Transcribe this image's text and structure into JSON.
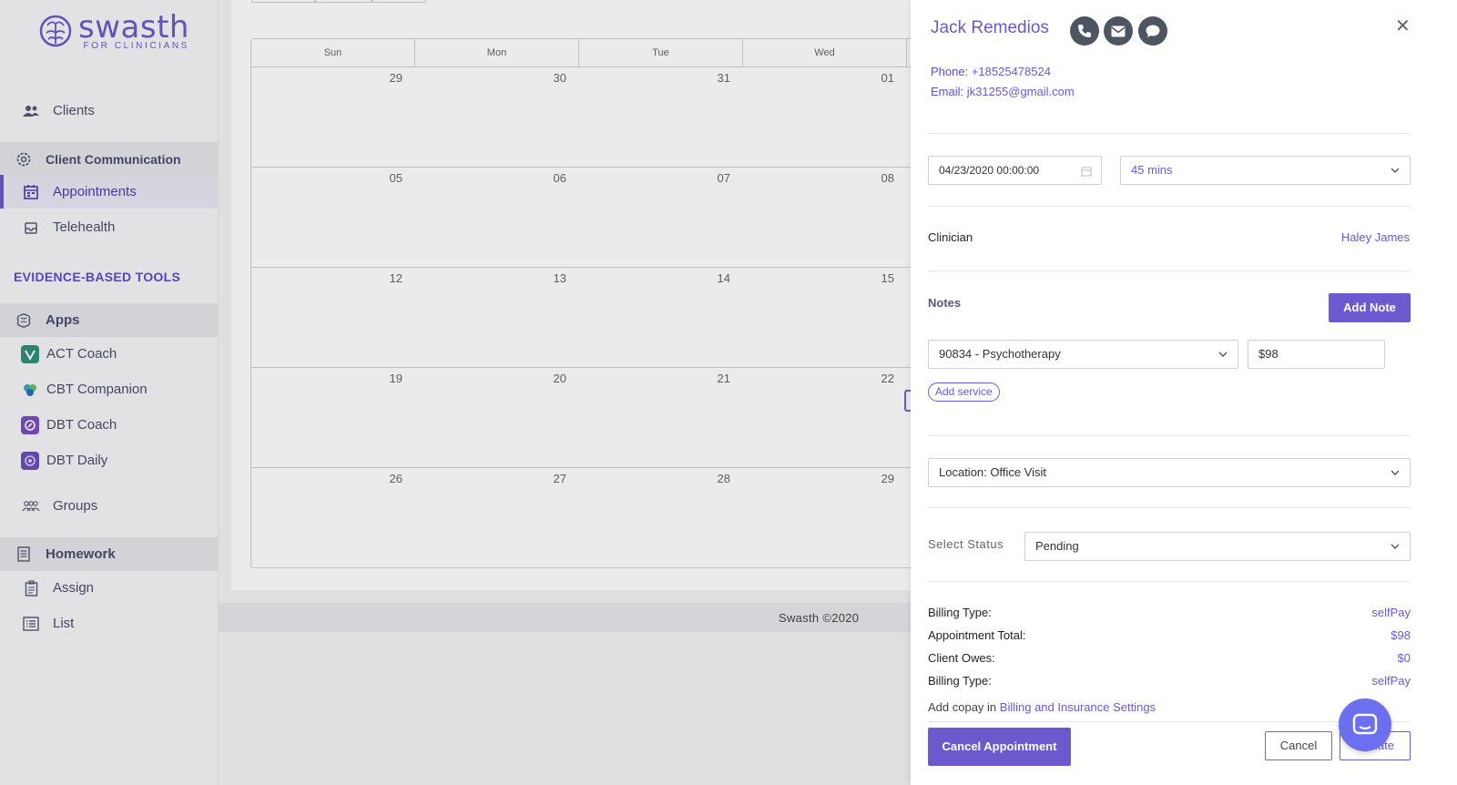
{
  "brand": {
    "name": "swasth",
    "tagline": "FOR CLINICIANS"
  },
  "sidebar": {
    "clients": "Clients",
    "client_communication": "Client Communication",
    "appointments": "Appointments",
    "telehealth": "Telehealth",
    "evidence_title": "EVIDENCE-BASED TOOLS",
    "apps": "Apps",
    "act_coach": "ACT Coach",
    "cbt_companion": "CBT Companion",
    "dbt_coach": "DBT Coach",
    "dbt_daily": "DBT Daily",
    "groups": "Groups",
    "homework": "Homework",
    "assign": "Assign",
    "list": "List"
  },
  "calendar": {
    "days": [
      "Sun",
      "Mon",
      "Tue",
      "Wed"
    ],
    "weeks": [
      [
        "29",
        "30",
        "31",
        "01"
      ],
      [
        "05",
        "06",
        "07",
        "08"
      ],
      [
        "12",
        "13",
        "14",
        "15"
      ],
      [
        "19",
        "20",
        "21",
        "22"
      ],
      [
        "26",
        "27",
        "28",
        "29"
      ]
    ]
  },
  "footer": {
    "text": "Swasth ©2020"
  },
  "drawer": {
    "client_name": "Jack Remedios",
    "phone_label": "Phone:",
    "phone": "+18525478524",
    "email_label": "Email:",
    "email": "jk31255@gmail.com",
    "datetime": "04/23/2020 00:00:00",
    "duration": "45 mins",
    "clinician_label": "Clinician",
    "clinician": "Haley James",
    "notes_label": "Notes",
    "add_note": "Add Note",
    "service": "90834 - Psychotherapy",
    "price": "$98",
    "add_service": "Add service",
    "location": "Location: Office Visit",
    "status_label": "Select Status",
    "status": "Pending",
    "billing": [
      {
        "label": "Billing Type:",
        "value": "selfPay"
      },
      {
        "label": "Appointment Total:",
        "value": "$98"
      },
      {
        "label": "Client Owes:",
        "value": "$0"
      },
      {
        "label": "Billing Type:",
        "value": "selfPay"
      }
    ],
    "copay_prefix": "Add copay in ",
    "copay_link": "Billing and Insurance Settings",
    "cancel_appointment": "Cancel Appointment",
    "cancel": "Cancel",
    "update": "Update"
  },
  "colors": {
    "accent": "#6a5acd",
    "icon_dark": "#4d5560",
    "chat": "#6b6ff0"
  }
}
